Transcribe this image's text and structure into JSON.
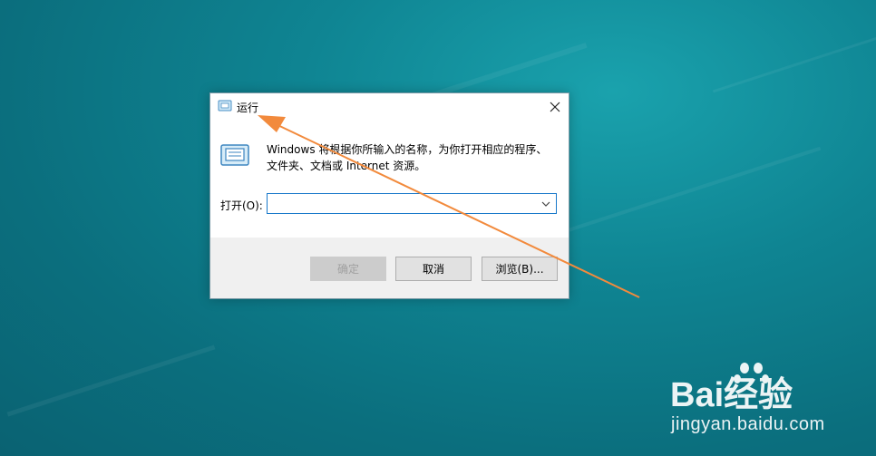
{
  "dialog": {
    "title": "运行",
    "description": "Windows 将根据你所输入的名称，为你打开相应的程序、文件夹、文档或 Internet 资源。",
    "open_label": "打开(O):",
    "input_value": "",
    "buttons": {
      "ok": "确定",
      "cancel": "取消",
      "browse": "浏览(B)..."
    }
  },
  "watermark": {
    "brand": "Bai经验",
    "url": "jingyan.baidu.com"
  },
  "colors": {
    "desktop": "#0f8593",
    "arrow": "#f28a3c",
    "focus_border": "#1979ca"
  },
  "icons": [
    "run-icon",
    "close-icon",
    "chevron-down-icon",
    "baidu-paw-icon"
  ]
}
